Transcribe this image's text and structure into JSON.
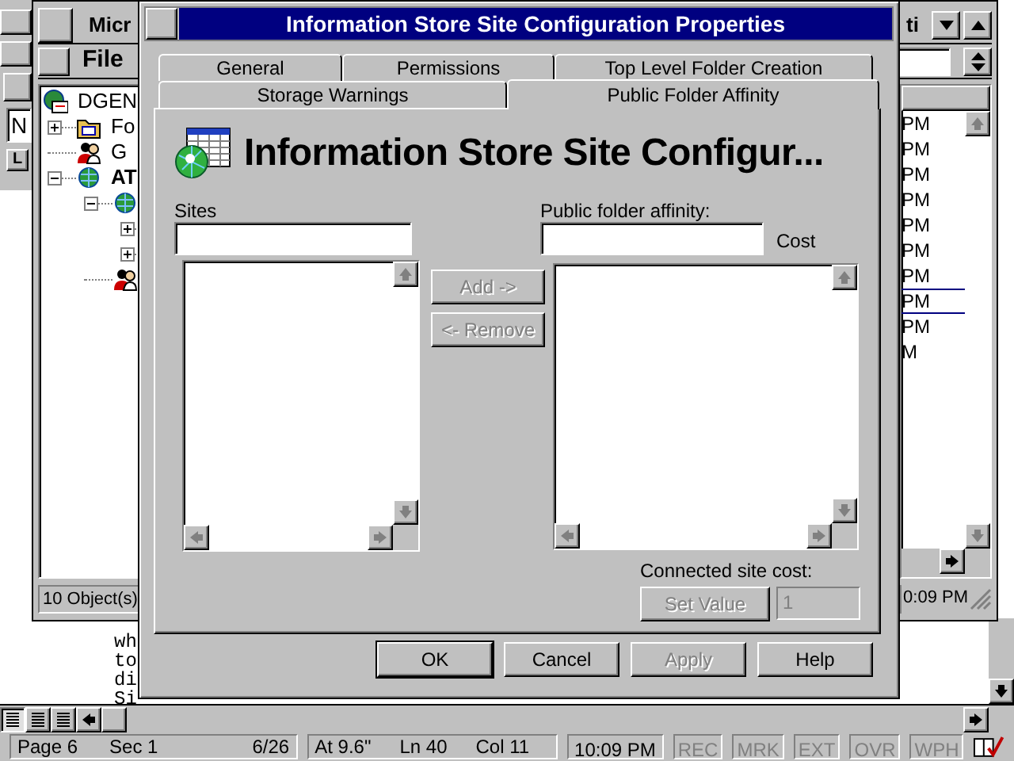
{
  "document": {
    "toolbar_fragments": [
      "N",
      "L"
    ],
    "lines": [
      "wh",
      "to",
      "di",
      "Si"
    ],
    "status_bar": {
      "page": "Page 6",
      "section": "Sec 1",
      "pages": "6/26",
      "position": "At 9.6\"",
      "line": "Ln 40",
      "column": "Col 11",
      "time": "10:09 PM",
      "indicators": [
        {
          "label": "REC",
          "on": false
        },
        {
          "label": "MRK",
          "on": false
        },
        {
          "label": "EXT",
          "on": false
        },
        {
          "label": "OVR",
          "on": false
        },
        {
          "label": "WPH",
          "on": false
        }
      ]
    }
  },
  "admin_window": {
    "title": "Micr",
    "title_end": "ti",
    "menu": [
      "File"
    ],
    "tree": [
      {
        "label": "DGEN",
        "kind": "site",
        "children": [
          {
            "label": "Fo",
            "kind": "folder",
            "expanded": false
          },
          {
            "label": "G",
            "kind": "people"
          },
          {
            "label": "AT",
            "kind": "globe",
            "expanded": true,
            "children": [
              {
                "kind": "globe",
                "expanded": true,
                "children": [
                  {
                    "expanded": false
                  },
                  {
                    "expanded": false
                  }
                ]
              },
              {
                "kind": "people"
              }
            ]
          }
        ]
      }
    ],
    "times": [
      {
        "text": "PM",
        "selected": false
      },
      {
        "text": "PM",
        "selected": false
      },
      {
        "text": "PM",
        "selected": false
      },
      {
        "text": "PM",
        "selected": false
      },
      {
        "text": "PM",
        "selected": false
      },
      {
        "text": "PM",
        "selected": false
      },
      {
        "text": "PM",
        "selected": false
      },
      {
        "text": "PM",
        "selected": true
      },
      {
        "text": "PM",
        "selected": false
      },
      {
        "text": "M",
        "selected": false
      }
    ],
    "status": "10 Object(s)",
    "status_time": "0:09 PM"
  },
  "dialog": {
    "title": "Information Store Site Configuration Properties",
    "tab_rows": [
      [
        {
          "label": "General",
          "selected": false
        },
        {
          "label": "Permissions",
          "selected": false
        },
        {
          "label": "Top Level Folder Creation",
          "selected": false
        }
      ],
      [
        {
          "label": "Storage Warnings",
          "selected": false
        },
        {
          "label": "Public Folder Affinity",
          "selected": true
        }
      ]
    ],
    "heading": "Information Store Site Configur...",
    "sites_label": "Sites",
    "add_button": {
      "label": "Add ->",
      "disabled": true
    },
    "remove_button": {
      "label": "<- Remove",
      "disabled": true
    },
    "affinity_label": "Public folder affinity:",
    "cost_label": "Cost",
    "connected_cost_label": "Connected site cost:",
    "set_value_button": {
      "label": "Set Value",
      "disabled": true
    },
    "cost_field": {
      "value": "1",
      "disabled": true
    },
    "buttons": [
      {
        "label": "OK",
        "disabled": false,
        "default": true
      },
      {
        "label": "Cancel",
        "disabled": false,
        "default": false
      },
      {
        "label": "Apply",
        "disabled": true,
        "default": false
      },
      {
        "label": "Help",
        "disabled": false,
        "default": false
      }
    ]
  }
}
